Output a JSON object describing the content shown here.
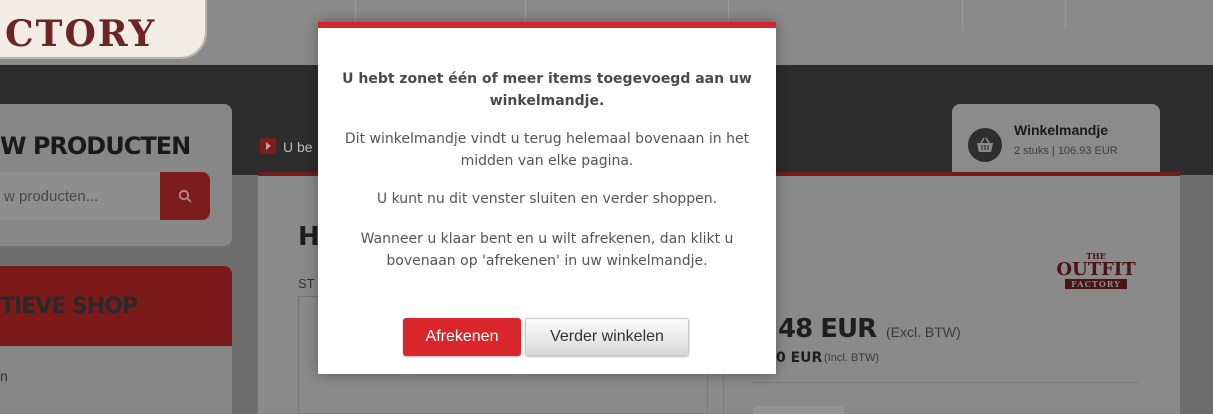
{
  "header": {
    "logo_text": "CTORY"
  },
  "search": {
    "title": "W PRODUCTEN",
    "placeholder": "w producten..."
  },
  "shop": {
    "title": "TIEVE SHOP",
    "first_item": "n"
  },
  "breadcrumb": {
    "text": "U be"
  },
  "cart": {
    "title": "Winkelmandje",
    "summary": "2 stuks | 106.93 EUR"
  },
  "product": {
    "heading": "H",
    "stock_label": "ST",
    "brand_the": "THE",
    "brand_outfit": "OUTFIT",
    "brand_factory": "FACTORY",
    "price_excl": "48 EUR",
    "price_excl_note": "(Excl. BTW)",
    "price_incl": "0 EUR",
    "price_incl_note": "(Incl. BTW)"
  },
  "modal": {
    "message_bold": "U hebt zonet één of meer items toegevoegd aan uw winkelmandje.",
    "message_location": "Dit winkelmandje vindt u terug helemaal bovenaan in het midden van elke pagina.",
    "message_continue": "U kunt nu dit venster sluiten en verder shoppen.",
    "message_checkout": "Wanneer u klaar bent en u wilt afrekenen, dan klikt u bovenaan op 'afrekenen' in uw winkelmandje.",
    "checkout_label": "Afrekenen",
    "continue_label": "Verder winkelen"
  },
  "colors": {
    "accent": "#d9262b",
    "overlay_dim": "#6e6e6e"
  }
}
